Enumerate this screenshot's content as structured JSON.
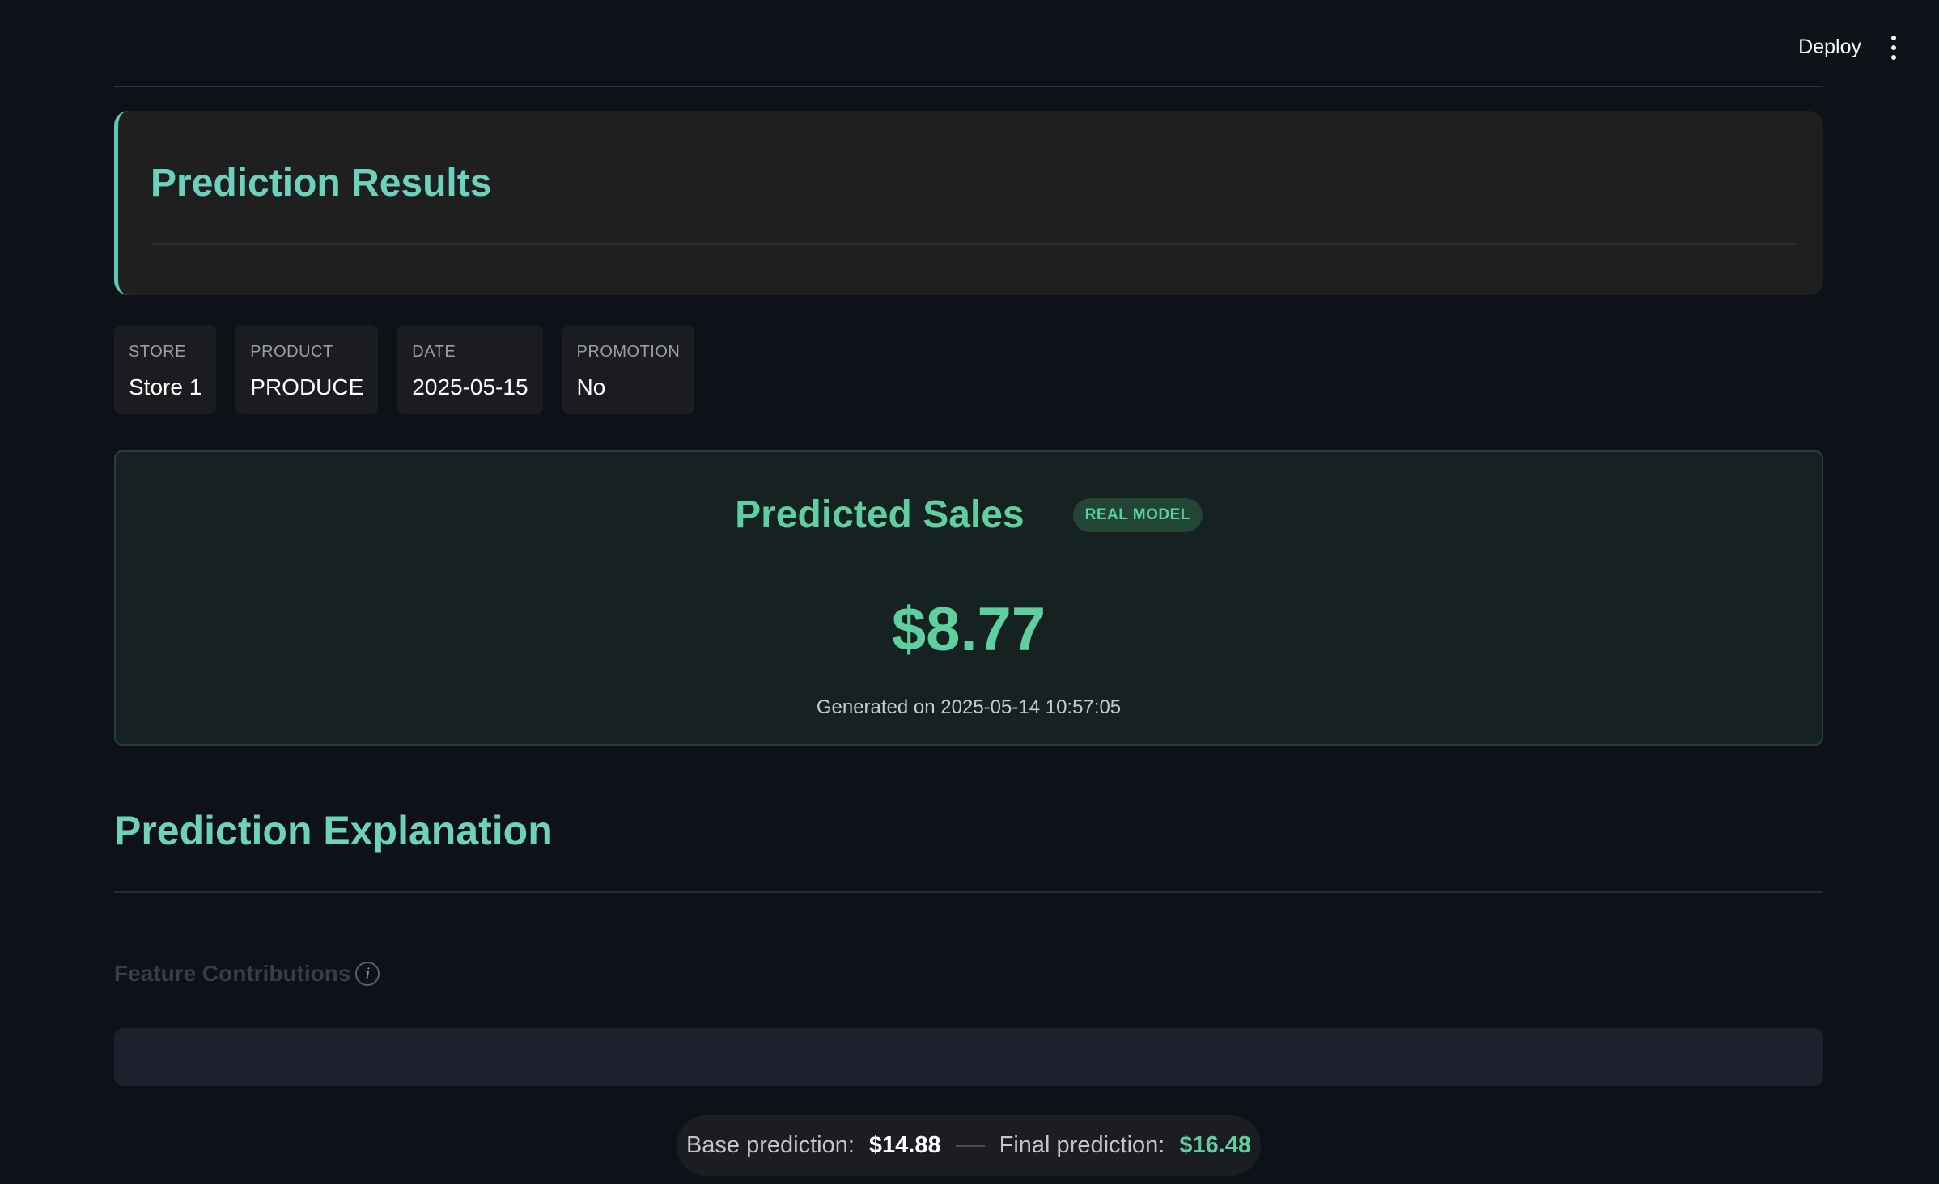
{
  "header": {
    "deploy_label": "Deploy",
    "menu_icon": "more-vertical-icon"
  },
  "results": {
    "title": "Prediction Results"
  },
  "info": [
    {
      "label": "STORE",
      "value": "Store 1"
    },
    {
      "label": "PRODUCT",
      "value": "PRODUCE"
    },
    {
      "label": "DATE",
      "value": "2025-05-15"
    },
    {
      "label": "PROMOTION",
      "value": "No"
    }
  ],
  "sales": {
    "title": "Predicted Sales",
    "badge": "REAL MODEL",
    "value": "$8.77",
    "generated": "Generated on 2025-05-14 10:57:05"
  },
  "explanation": {
    "title": "Prediction Explanation",
    "feature_label": "Feature Contributions",
    "info_icon": "info-icon"
  },
  "summary": {
    "base_label": "Base prediction:",
    "base_value": "$14.88",
    "final_label": "Final prediction:",
    "final_value": "$16.48"
  },
  "colors": {
    "accent_teal": "#6cd1bd",
    "accent_green": "#5fcf9f",
    "background": "#0e1117"
  }
}
